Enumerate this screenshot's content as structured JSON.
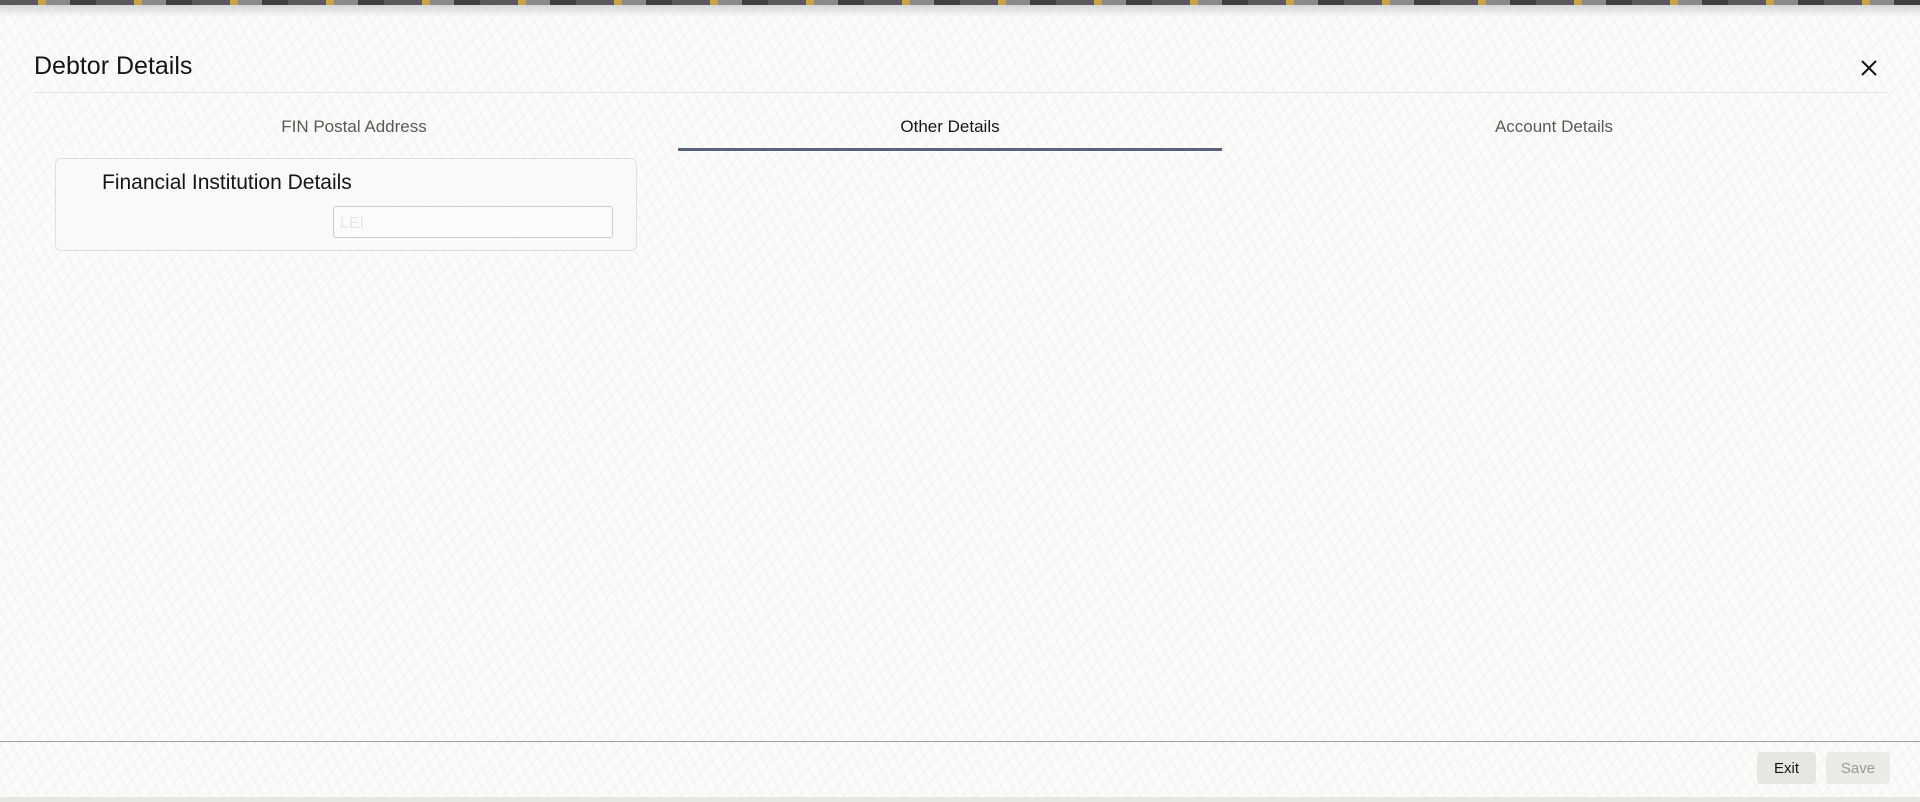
{
  "dialog": {
    "title": "Debtor Details",
    "close_icon": "close-icon"
  },
  "tabs": [
    {
      "label": "FIN Postal Address",
      "active": false
    },
    {
      "label": "Other Details",
      "active": true
    },
    {
      "label": "Account Details",
      "active": false
    }
  ],
  "financial_institution": {
    "heading": "Financial Institution Details",
    "lei_label": "LEI",
    "lei_value": ""
  },
  "footer": {
    "exit_label": "Exit",
    "save_label": "Save"
  },
  "colors": {
    "active_tab_underline": "#5b6379",
    "text": "#161513",
    "muted_text": "#5b5955"
  }
}
